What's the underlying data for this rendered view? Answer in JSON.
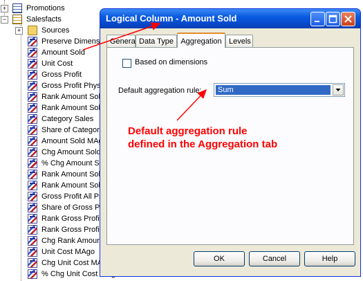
{
  "tree": {
    "items": [
      {
        "label": "Promotions",
        "icon": "table-icon",
        "indent": 1,
        "expander": "+"
      },
      {
        "label": "Salesfacts",
        "icon": "fact-table-icon",
        "indent": 1,
        "expander": "-"
      },
      {
        "label": "Sources",
        "icon": "folder-icon",
        "indent": 2,
        "expander": "+"
      },
      {
        "label": "Preserve Dimensi",
        "icon": "logical-column-icon",
        "indent": 2
      },
      {
        "label": "Amount Sold",
        "icon": "logical-column-icon",
        "indent": 2
      },
      {
        "label": "Unit Cost",
        "icon": "logical-column-icon",
        "indent": 2
      },
      {
        "label": "Gross Profit",
        "icon": "logical-column-icon",
        "indent": 2
      },
      {
        "label": "Gross Profit Physi",
        "icon": "logical-column-icon",
        "indent": 2
      },
      {
        "label": "Rank Amount Sol",
        "icon": "logical-column-icon",
        "indent": 2
      },
      {
        "label": "Rank Amount Sol",
        "icon": "logical-column-icon",
        "indent": 2
      },
      {
        "label": "Category Sales",
        "icon": "logical-column-icon",
        "indent": 2
      },
      {
        "label": "Share of Categor",
        "icon": "logical-column-icon",
        "indent": 2
      },
      {
        "label": "Amount Sold MAg",
        "icon": "logical-column-icon",
        "indent": 2
      },
      {
        "label": "Chg Amount Sold",
        "icon": "logical-column-icon",
        "indent": 2
      },
      {
        "label": "% Chg Amount Sol",
        "icon": "logical-column-icon",
        "indent": 2
      },
      {
        "label": "Rank Amount Sol",
        "icon": "logical-column-icon",
        "indent": 2
      },
      {
        "label": "Rank Amount Sol",
        "icon": "logical-column-icon",
        "indent": 2
      },
      {
        "label": "Gross Profit All Pr",
        "icon": "logical-column-icon",
        "indent": 2
      },
      {
        "label": "Share of Gross Pr",
        "icon": "logical-column-icon",
        "indent": 2
      },
      {
        "label": "Rank Gross Profi",
        "icon": "logical-column-icon",
        "indent": 2
      },
      {
        "label": "Rank Gross Profi",
        "icon": "logical-column-icon",
        "indent": 2
      },
      {
        "label": "Chg Rank Amour",
        "icon": "logical-column-icon",
        "indent": 2
      },
      {
        "label": "Unit Cost MAgo",
        "icon": "logical-column-icon",
        "indent": 2
      },
      {
        "label": "Chg Unit Cost MA",
        "icon": "logical-column-icon",
        "indent": 2
      },
      {
        "label": "% Chg Unit Cost MAgo",
        "icon": "logical-column-icon",
        "indent": 2
      }
    ]
  },
  "dialog": {
    "title": "Logical Column - Amount Sold",
    "tabs": [
      {
        "label": "General",
        "active": false
      },
      {
        "label": "Data Type",
        "active": false
      },
      {
        "label": "Aggregation",
        "active": true
      },
      {
        "label": "Levels",
        "active": false
      }
    ],
    "based_on_dimensions_label": "Based on dimensions",
    "based_on_dimensions_checked": false,
    "aggregation_rule_label": "Default aggregation rule:",
    "aggregation_rule_value": "Sum",
    "ok_label": "OK",
    "cancel_label": "Cancel",
    "help_label": "Help"
  },
  "annotation": {
    "line1": "Default aggregation rule",
    "line2": "defined in the Aggregation tab",
    "color": "#ff0000"
  },
  "colors": {
    "titlebar": "#0a5be0",
    "dialog_face": "#ece9d8",
    "selection": "#316ac5",
    "active_tab_accent": "#e68b2c"
  }
}
